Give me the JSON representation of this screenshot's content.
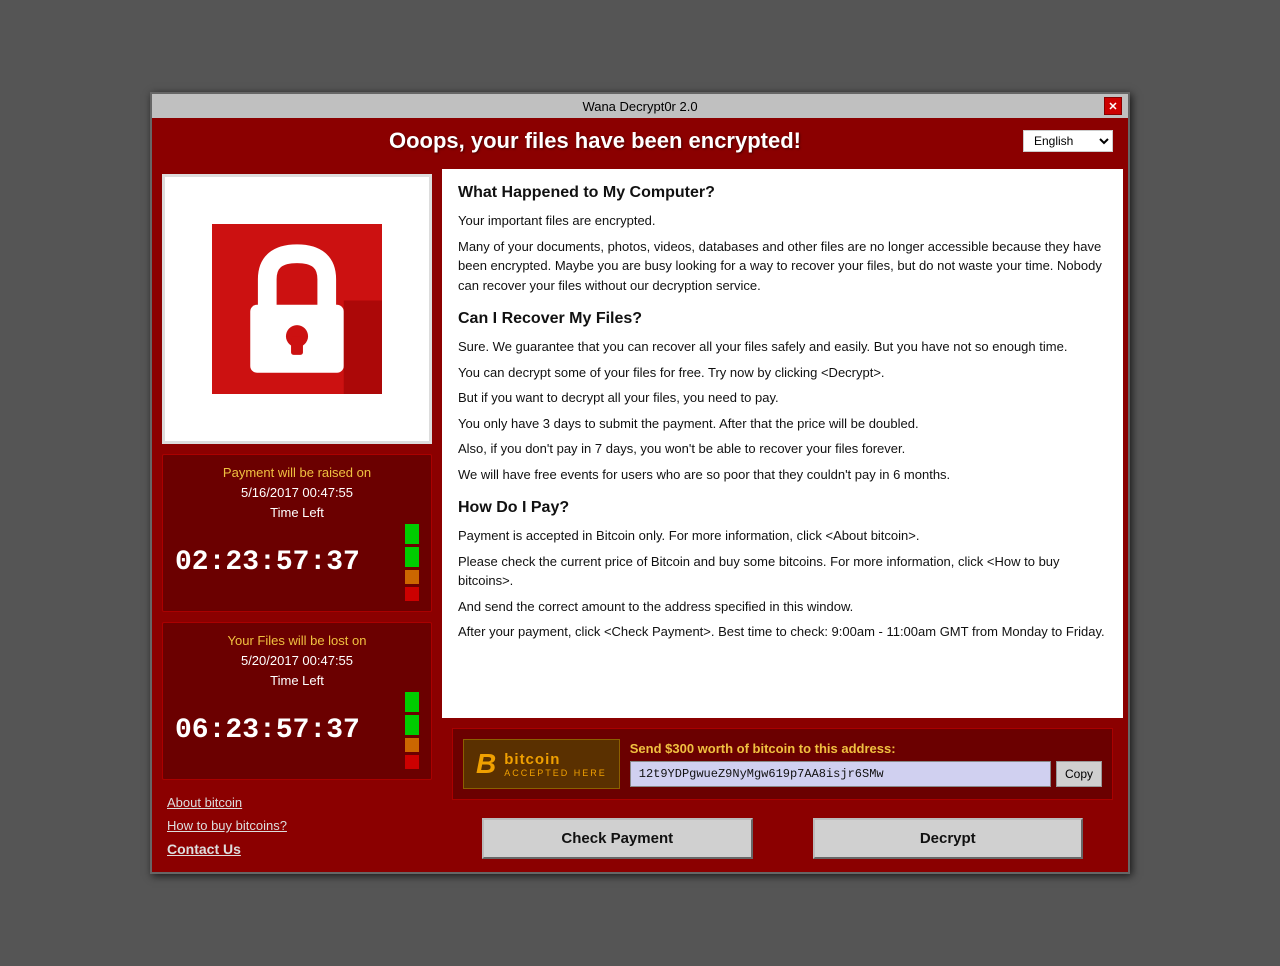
{
  "window": {
    "title": "Wana Decrypt0r 2.0",
    "close_label": "✕"
  },
  "header": {
    "title": "Ooops, your files have been encrypted!",
    "language_default": "English"
  },
  "left": {
    "timer1": {
      "title": "Payment will be raised on",
      "date": "5/16/2017 00:47:55",
      "time_left_label": "Time Left",
      "time": "02:23:57:37"
    },
    "timer2": {
      "title": "Your Files will be lost on",
      "date": "5/20/2017 00:47:55",
      "time_left_label": "Time Left",
      "time": "06:23:57:37"
    },
    "links": {
      "about": "About bitcoin",
      "how_to_buy": "How to buy bitcoins?",
      "contact": "Contact Us"
    }
  },
  "content": {
    "sections": [
      {
        "heading": "What Happened to My Computer?",
        "body": "Your important files are encrypted.\nMany of your documents, photos, videos, databases and other files are no longer accessible because they have been encrypted. Maybe you are busy looking for a way to recover your files, but do not waste your time. Nobody can recover your files without our decryption service."
      },
      {
        "heading": "Can I Recover My Files?",
        "body": "Sure. We guarantee that you can recover all your files safely and easily. But you have not so enough time.\nYou can decrypt some of your files for free. Try now by clicking <Decrypt>.\nBut if you want to decrypt all your files, you need to pay.\nYou only have 3 days to submit the payment. After that the price will be doubled.\nAlso, if you don't pay in 7 days, you won't be able to recover your files forever.\nWe will have free events for users who are so poor that they couldn't pay in 6 months."
      },
      {
        "heading": "How Do I Pay?",
        "body": "Payment is accepted in Bitcoin only. For more information, click <About bitcoin>.\nPlease check the current price of Bitcoin and buy some bitcoins. For more information, click <How to buy bitcoins>.\nAnd send the correct amount to the address specified in this window.\nAfter your payment, click <Check Payment>. Best time to check: 9:00am - 11:00am GMT from Monday to Friday."
      }
    ]
  },
  "bitcoin": {
    "logo_b": "B",
    "logo_word": "bitcoin",
    "logo_sub": "ACCEPTED HERE",
    "send_label": "Send $300 worth of bitcoin to this address:",
    "address": "12t9YDPgwueZ9NyMgw619p7AA8isjr6SMw",
    "copy_label": "Copy"
  },
  "buttons": {
    "check_payment": "Check Payment",
    "decrypt": "Decrypt"
  }
}
